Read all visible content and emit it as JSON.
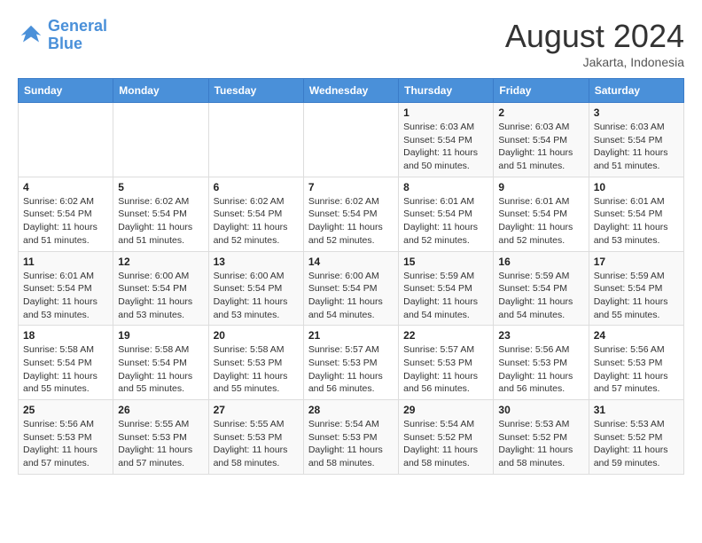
{
  "header": {
    "logo_line1": "General",
    "logo_line2": "Blue",
    "month_year": "August 2024",
    "location": "Jakarta, Indonesia"
  },
  "weekdays": [
    "Sunday",
    "Monday",
    "Tuesday",
    "Wednesday",
    "Thursday",
    "Friday",
    "Saturday"
  ],
  "weeks": [
    [
      {
        "day": "",
        "info": ""
      },
      {
        "day": "",
        "info": ""
      },
      {
        "day": "",
        "info": ""
      },
      {
        "day": "",
        "info": ""
      },
      {
        "day": "1",
        "info": "Sunrise: 6:03 AM\nSunset: 5:54 PM\nDaylight: 11 hours\nand 50 minutes."
      },
      {
        "day": "2",
        "info": "Sunrise: 6:03 AM\nSunset: 5:54 PM\nDaylight: 11 hours\nand 51 minutes."
      },
      {
        "day": "3",
        "info": "Sunrise: 6:03 AM\nSunset: 5:54 PM\nDaylight: 11 hours\nand 51 minutes."
      }
    ],
    [
      {
        "day": "4",
        "info": "Sunrise: 6:02 AM\nSunset: 5:54 PM\nDaylight: 11 hours\nand 51 minutes."
      },
      {
        "day": "5",
        "info": "Sunrise: 6:02 AM\nSunset: 5:54 PM\nDaylight: 11 hours\nand 51 minutes."
      },
      {
        "day": "6",
        "info": "Sunrise: 6:02 AM\nSunset: 5:54 PM\nDaylight: 11 hours\nand 52 minutes."
      },
      {
        "day": "7",
        "info": "Sunrise: 6:02 AM\nSunset: 5:54 PM\nDaylight: 11 hours\nand 52 minutes."
      },
      {
        "day": "8",
        "info": "Sunrise: 6:01 AM\nSunset: 5:54 PM\nDaylight: 11 hours\nand 52 minutes."
      },
      {
        "day": "9",
        "info": "Sunrise: 6:01 AM\nSunset: 5:54 PM\nDaylight: 11 hours\nand 52 minutes."
      },
      {
        "day": "10",
        "info": "Sunrise: 6:01 AM\nSunset: 5:54 PM\nDaylight: 11 hours\nand 53 minutes."
      }
    ],
    [
      {
        "day": "11",
        "info": "Sunrise: 6:01 AM\nSunset: 5:54 PM\nDaylight: 11 hours\nand 53 minutes."
      },
      {
        "day": "12",
        "info": "Sunrise: 6:00 AM\nSunset: 5:54 PM\nDaylight: 11 hours\nand 53 minutes."
      },
      {
        "day": "13",
        "info": "Sunrise: 6:00 AM\nSunset: 5:54 PM\nDaylight: 11 hours\nand 53 minutes."
      },
      {
        "day": "14",
        "info": "Sunrise: 6:00 AM\nSunset: 5:54 PM\nDaylight: 11 hours\nand 54 minutes."
      },
      {
        "day": "15",
        "info": "Sunrise: 5:59 AM\nSunset: 5:54 PM\nDaylight: 11 hours\nand 54 minutes."
      },
      {
        "day": "16",
        "info": "Sunrise: 5:59 AM\nSunset: 5:54 PM\nDaylight: 11 hours\nand 54 minutes."
      },
      {
        "day": "17",
        "info": "Sunrise: 5:59 AM\nSunset: 5:54 PM\nDaylight: 11 hours\nand 55 minutes."
      }
    ],
    [
      {
        "day": "18",
        "info": "Sunrise: 5:58 AM\nSunset: 5:54 PM\nDaylight: 11 hours\nand 55 minutes."
      },
      {
        "day": "19",
        "info": "Sunrise: 5:58 AM\nSunset: 5:54 PM\nDaylight: 11 hours\nand 55 minutes."
      },
      {
        "day": "20",
        "info": "Sunrise: 5:58 AM\nSunset: 5:53 PM\nDaylight: 11 hours\nand 55 minutes."
      },
      {
        "day": "21",
        "info": "Sunrise: 5:57 AM\nSunset: 5:53 PM\nDaylight: 11 hours\nand 56 minutes."
      },
      {
        "day": "22",
        "info": "Sunrise: 5:57 AM\nSunset: 5:53 PM\nDaylight: 11 hours\nand 56 minutes."
      },
      {
        "day": "23",
        "info": "Sunrise: 5:56 AM\nSunset: 5:53 PM\nDaylight: 11 hours\nand 56 minutes."
      },
      {
        "day": "24",
        "info": "Sunrise: 5:56 AM\nSunset: 5:53 PM\nDaylight: 11 hours\nand 57 minutes."
      }
    ],
    [
      {
        "day": "25",
        "info": "Sunrise: 5:56 AM\nSunset: 5:53 PM\nDaylight: 11 hours\nand 57 minutes."
      },
      {
        "day": "26",
        "info": "Sunrise: 5:55 AM\nSunset: 5:53 PM\nDaylight: 11 hours\nand 57 minutes."
      },
      {
        "day": "27",
        "info": "Sunrise: 5:55 AM\nSunset: 5:53 PM\nDaylight: 11 hours\nand 58 minutes."
      },
      {
        "day": "28",
        "info": "Sunrise: 5:54 AM\nSunset: 5:53 PM\nDaylight: 11 hours\nand 58 minutes."
      },
      {
        "day": "29",
        "info": "Sunrise: 5:54 AM\nSunset: 5:52 PM\nDaylight: 11 hours\nand 58 minutes."
      },
      {
        "day": "30",
        "info": "Sunrise: 5:53 AM\nSunset: 5:52 PM\nDaylight: 11 hours\nand 58 minutes."
      },
      {
        "day": "31",
        "info": "Sunrise: 5:53 AM\nSunset: 5:52 PM\nDaylight: 11 hours\nand 59 minutes."
      }
    ]
  ]
}
